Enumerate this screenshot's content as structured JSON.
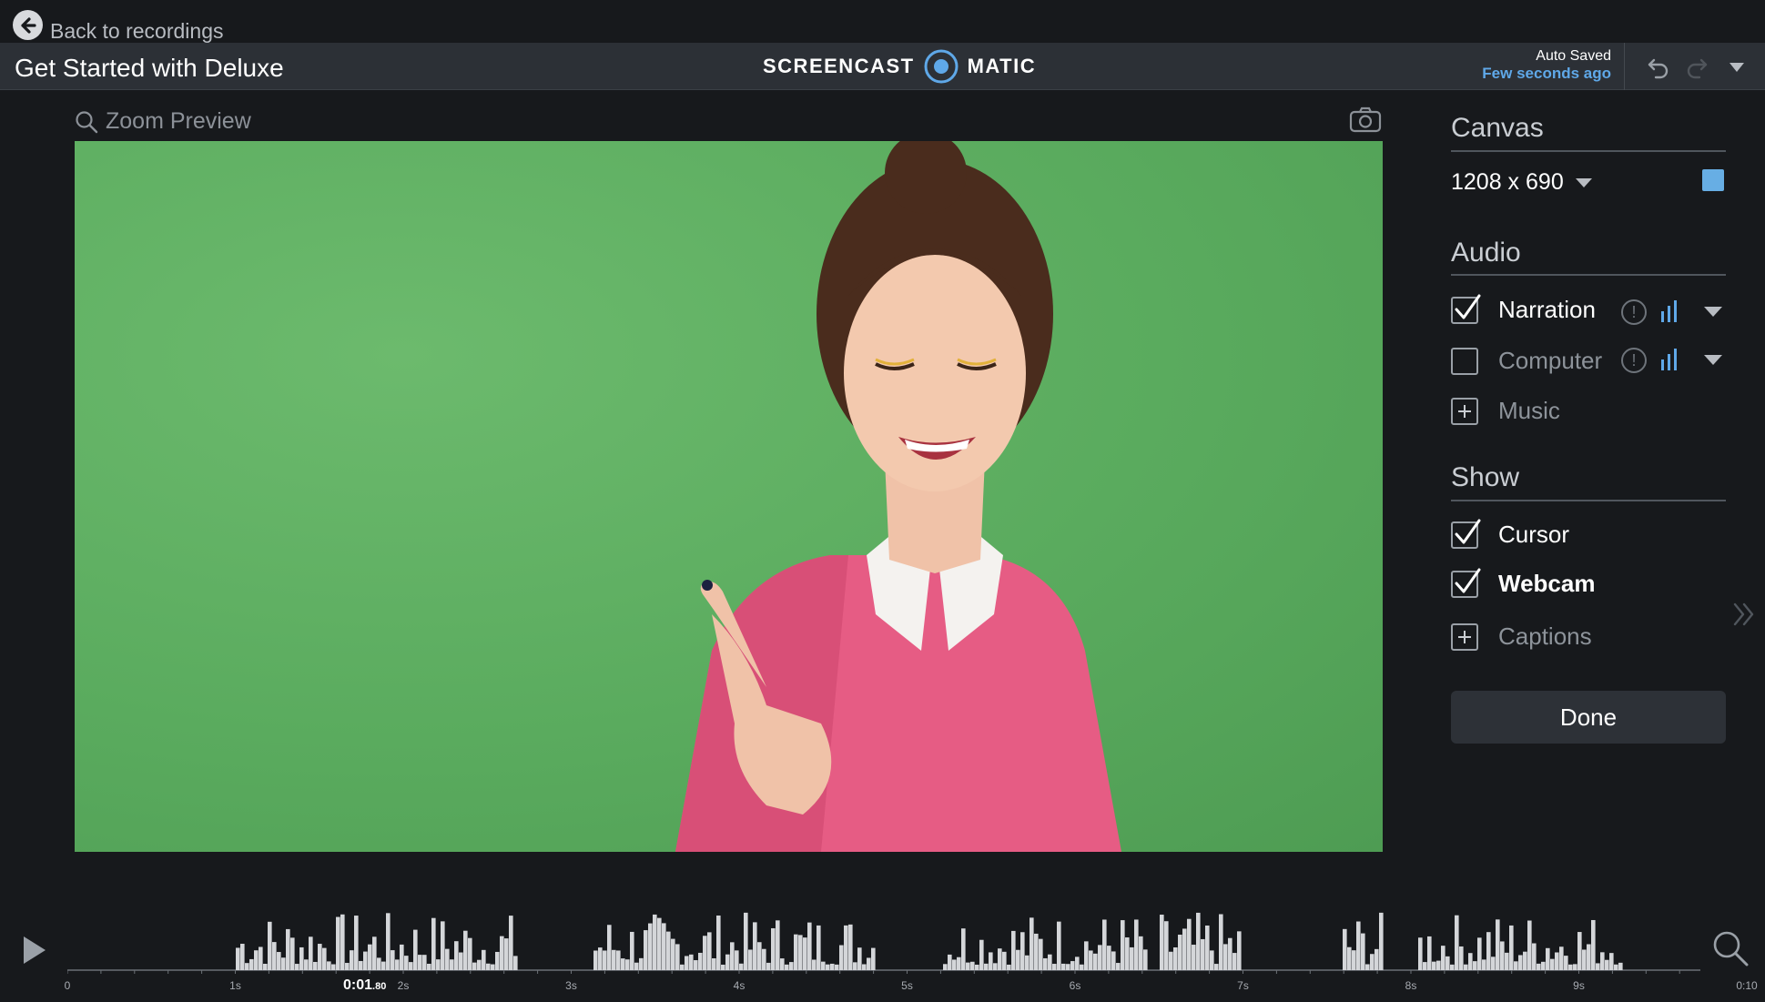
{
  "top": {
    "back_label": "Back to recordings"
  },
  "header": {
    "title": "Get Started with Deluxe",
    "brand_left": "SCREENCAST",
    "brand_right": "MATIC",
    "autosave_label": "Auto Saved",
    "autosave_time": "Few seconds ago"
  },
  "preview": {
    "zoom_label": "Zoom Preview",
    "image": "green-screen-woman-laughing-pointing"
  },
  "panel": {
    "canvas": {
      "heading": "Canvas",
      "size": "1208 x 690",
      "color": "#67aee4"
    },
    "audio": {
      "heading": "Audio",
      "narration": {
        "label": "Narration",
        "checked": true
      },
      "computer": {
        "label": "Computer",
        "checked": false
      },
      "music": {
        "label": "Music"
      }
    },
    "show": {
      "heading": "Show",
      "cursor": {
        "label": "Cursor",
        "checked": true
      },
      "webcam": {
        "label": "Webcam",
        "checked": true
      },
      "captions": {
        "label": "Captions"
      }
    },
    "done_label": "Done"
  },
  "timeline": {
    "current_time": "0:01",
    "current_time_frac": ".80",
    "tick_labels": [
      "0",
      "1s",
      "2s",
      "3s",
      "4s",
      "5s",
      "6s",
      "7s",
      "8s",
      "9s",
      "0:10"
    ]
  },
  "colors": {
    "accent": "#5fa8e8",
    "background": "#17191c",
    "titlebar": "#2c3036"
  }
}
